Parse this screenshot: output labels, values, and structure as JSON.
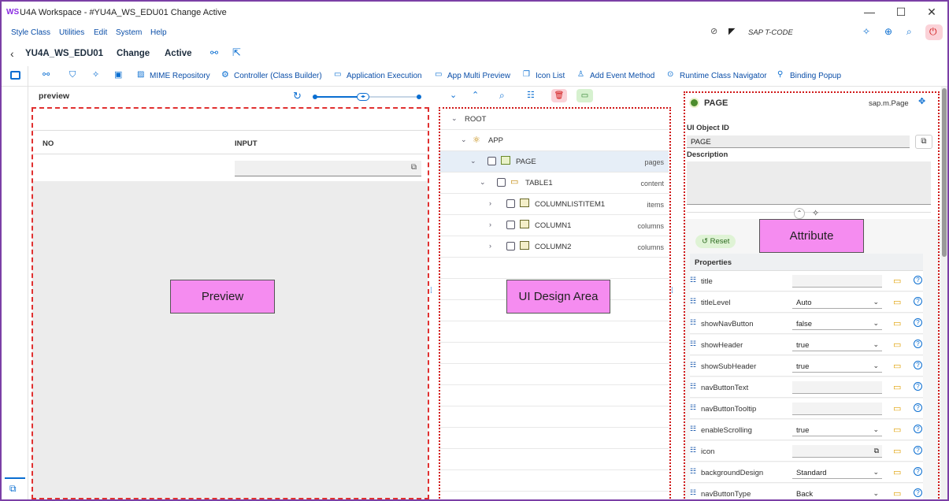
{
  "window": {
    "logo": "WS",
    "title": "U4A Workspace - #YU4A_WS_EDU01 Change Active",
    "minimize": "—",
    "maximize": "☐",
    "close": "✕"
  },
  "menu": {
    "items": [
      "Style Class",
      "Utilities",
      "Edit",
      "System",
      "Help"
    ],
    "tcode": "SAP T-CODE"
  },
  "header": {
    "back": "‹",
    "app_name": "YU4A_WS_EDU01",
    "mode": "Change",
    "status": "Active"
  },
  "toolbar": {
    "mime": "MIME Repository",
    "controller": "Controller (Class Builder)",
    "app_exec": "Application Execution",
    "multi_preview": "App Multi Preview",
    "icon_list": "Icon List",
    "add_event": "Add Event Method",
    "runtime_nav": "Runtime Class Navigator",
    "binding_popup": "Binding Popup"
  },
  "preview": {
    "title": "preview",
    "columns": [
      "NO",
      "INPUT"
    ],
    "annotation": "Preview"
  },
  "design": {
    "annotation": "UI Design Area",
    "tree": [
      {
        "label": "ROOT",
        "agg": ""
      },
      {
        "label": "APP",
        "agg": ""
      },
      {
        "label": "PAGE",
        "agg": "pages"
      },
      {
        "label": "TABLE1",
        "agg": "content"
      },
      {
        "label": "COLUMNLISTITEM1",
        "agg": "items"
      },
      {
        "label": "COLUMN1",
        "agg": "columns"
      },
      {
        "label": "COLUMN2",
        "agg": "columns"
      }
    ]
  },
  "attribute": {
    "title": "PAGE",
    "class_name": "sap.m.Page",
    "ui_object_id_label": "UI Object ID",
    "ui_object_id": "PAGE",
    "description_label": "Description",
    "reset": "Reset",
    "properties_label": "Properties",
    "annotation": "Attribute",
    "properties": [
      {
        "name": "title",
        "value": "",
        "kind": "input"
      },
      {
        "name": "titleLevel",
        "value": "Auto",
        "kind": "select"
      },
      {
        "name": "showNavButton",
        "value": "false",
        "kind": "select"
      },
      {
        "name": "showHeader",
        "value": "true",
        "kind": "select"
      },
      {
        "name": "showSubHeader",
        "value": "true",
        "kind": "select"
      },
      {
        "name": "navButtonText",
        "value": "",
        "kind": "input"
      },
      {
        "name": "navButtonTooltip",
        "value": "",
        "kind": "input"
      },
      {
        "name": "enableScrolling",
        "value": "true",
        "kind": "select"
      },
      {
        "name": "icon",
        "value": "",
        "kind": "input"
      },
      {
        "name": "backgroundDesign",
        "value": "Standard",
        "kind": "select"
      },
      {
        "name": "navButtonType",
        "value": "Back",
        "kind": "select"
      }
    ]
  }
}
